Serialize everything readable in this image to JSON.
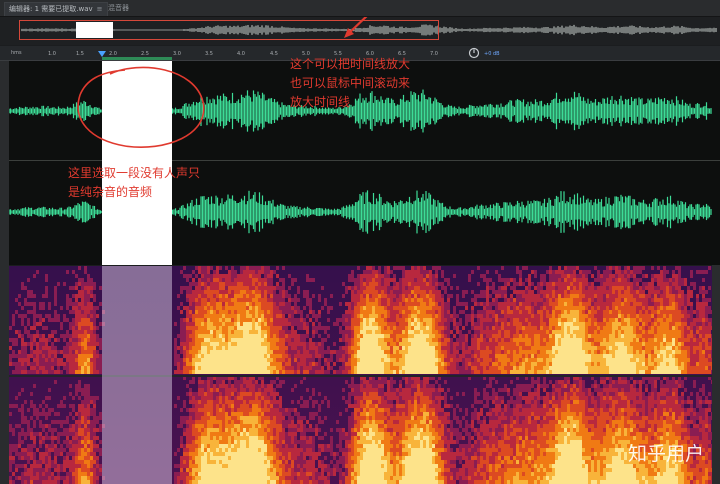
{
  "tabs": {
    "editor_label": "编辑器: 1 需要已提取.wav",
    "menu_icon": "≡",
    "mixer_label": "混音器"
  },
  "ruler": {
    "unit": "hms",
    "ticks": [
      "1.0",
      "1.5",
      "2.0",
      "2.5",
      "3.0",
      "3.5",
      "4.0",
      "4.5",
      "5.0",
      "5.5",
      "6.0",
      "6.5",
      "7.0"
    ],
    "db_label": "+0 dB"
  },
  "selection": {
    "start_s": 1.95,
    "end_s": 2.95
  },
  "annotations": {
    "zoom_note_line1": "这个可以把时间线放大",
    "zoom_note_line2": "也可以鼠标中间滚动来",
    "zoom_note_line3": "放大时间线",
    "select_note_line1": "这里选取一段没有人声只",
    "select_note_line2": "是纯杂音的音频"
  },
  "watermark": "知乎用户",
  "colors": {
    "waveform": "#3ddc97",
    "annotation": "#e03a2f",
    "selection": "#ffffff"
  },
  "icons": [
    "menu-icon",
    "zoom-dial-icon",
    "arrow-icon"
  ]
}
